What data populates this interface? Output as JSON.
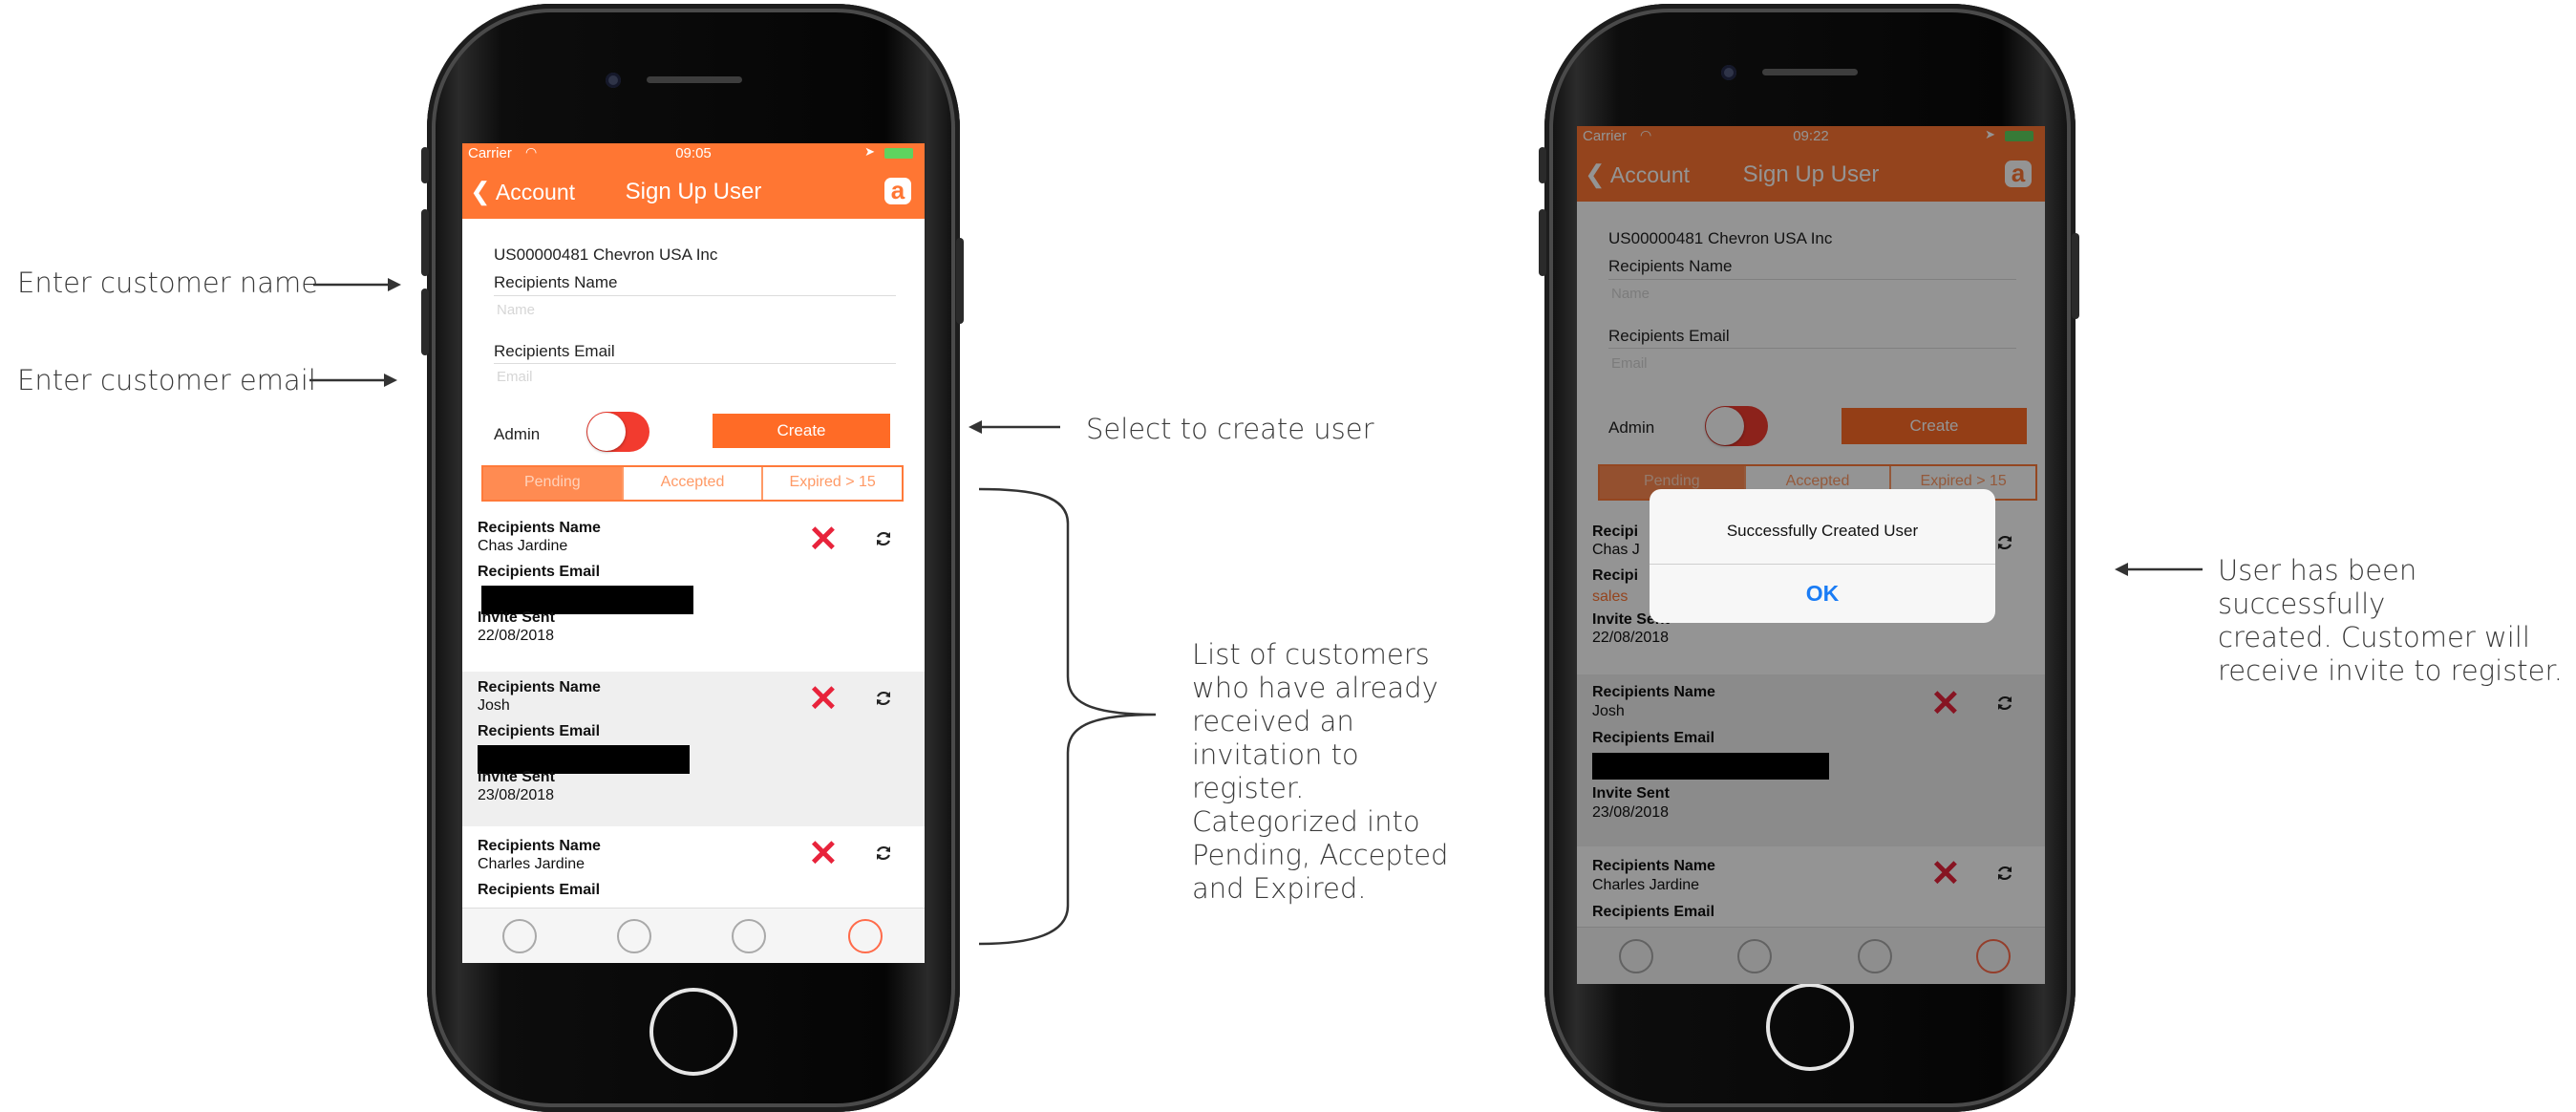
{
  "annotations": {
    "enter_name": "Enter customer name",
    "enter_email": "Enter customer email",
    "select_create": "Select to create user",
    "list_description": [
      "List of customers",
      "who have already",
      "received an",
      "invitation to",
      "register.",
      "Categorized into",
      "Pending, Accepted",
      "and Expired."
    ],
    "success_description": [
      "User has been successfully",
      "created. Customer will",
      "receive invite to register."
    ]
  },
  "phone_left": {
    "status": {
      "carrier": "Carrier",
      "time": "09:05"
    },
    "nav": {
      "back": "Account",
      "title": "Sign Up User",
      "logo": "a"
    },
    "form": {
      "account": "US00000481 Chevron USA Inc",
      "name_label": "Recipients Name",
      "name_placeholder": "Name",
      "email_label": "Recipients Email",
      "email_placeholder": "Email",
      "admin_label": "Admin",
      "create_button": "Create"
    },
    "tabs": [
      "Pending",
      "Accepted",
      "Expired > 15"
    ],
    "list": [
      {
        "name_label": "Recipients Name",
        "name": "Chas Jardine",
        "email_label": "Recipients Email",
        "sent_label": "Invite Sent",
        "sent": "22/08/2018"
      },
      {
        "name_label": "Recipients Name",
        "name": "Josh",
        "email_label": "Recipients Email",
        "sent_label": "Invite Sent",
        "sent": "23/08/2018"
      },
      {
        "name_label": "Recipients Name",
        "name": "Charles Jardine",
        "email_label": "Recipients Email"
      }
    ]
  },
  "phone_right": {
    "status": {
      "carrier": "Carrier",
      "time": "09:22"
    },
    "nav": {
      "back": "Account",
      "title": "Sign Up User",
      "logo": "a"
    },
    "form": {
      "account": "US00000481 Chevron USA Inc",
      "name_label": "Recipients Name",
      "name_placeholder": "Name",
      "email_label": "Recipients Email",
      "email_placeholder": "Email",
      "admin_label": "Admin",
      "create_button": "Create"
    },
    "tabs": [
      "Pending",
      "Accepted",
      "Expired > 15"
    ],
    "list": [
      {
        "name_label": "Recipi",
        "name": "Chas J",
        "email_label": "Recipi",
        "email_partial": "sales",
        "sent_label": "Invite Sent",
        "sent": "22/08/2018"
      },
      {
        "name_label": "Recipients Name",
        "name": "Josh",
        "email_label": "Recipients Email",
        "sent_label": "Invite Sent",
        "sent": "23/08/2018"
      },
      {
        "name_label": "Recipients Name",
        "name": "Charles Jardine",
        "email_label": "Recipients Email"
      }
    ],
    "alert": {
      "message": "Successfully Created User",
      "ok": "OK"
    }
  },
  "colors": {
    "brand": "#ff7633",
    "delete": "#e8233b",
    "alert_action": "#1a7cf5"
  }
}
